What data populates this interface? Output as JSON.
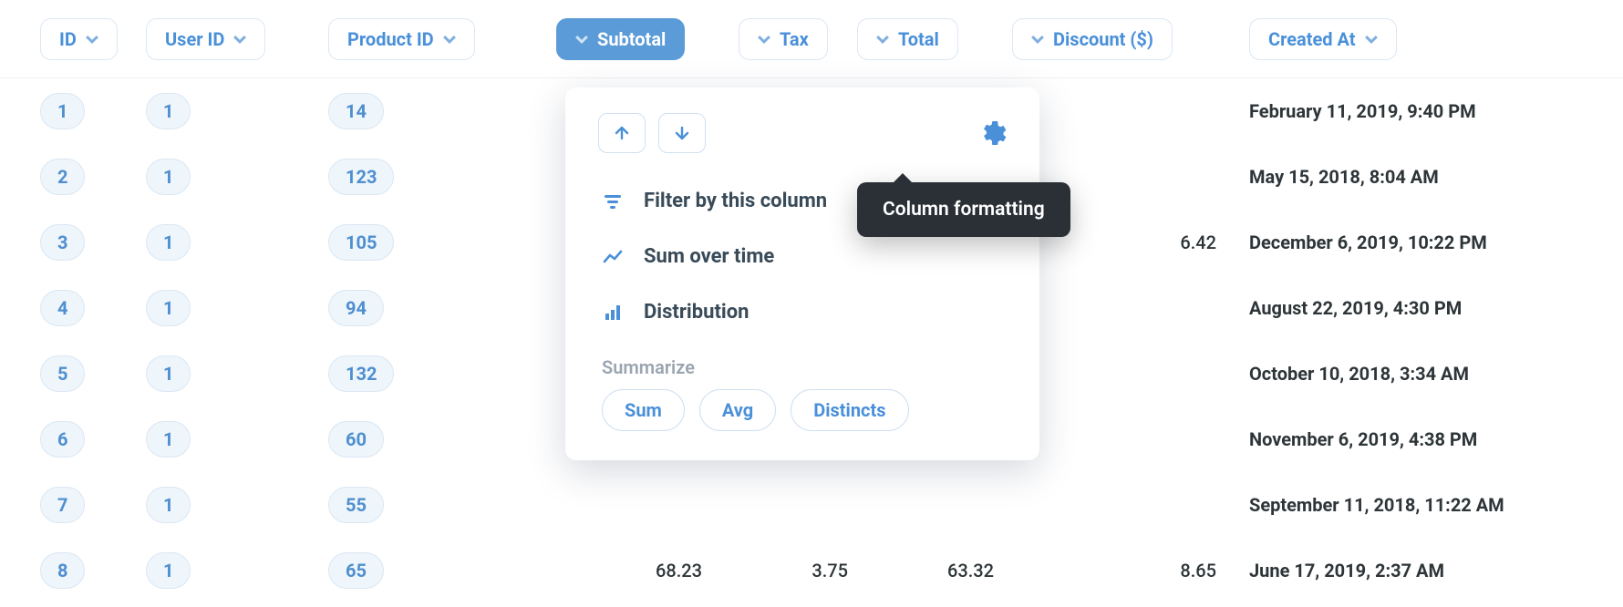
{
  "columns": {
    "id": "ID",
    "user_id": "User ID",
    "product_id": "Product ID",
    "subtotal": "Subtotal",
    "tax": "Tax",
    "total": "Total",
    "discount": "Discount ($)",
    "created_at": "Created At"
  },
  "active_column": "subtotal",
  "rows": [
    {
      "id": "1",
      "user_id": "1",
      "product_id": "14",
      "subtotal": "",
      "tax": "",
      "total": "",
      "discount": "",
      "created_at": "February 11, 2019, 9:40 PM"
    },
    {
      "id": "2",
      "user_id": "1",
      "product_id": "123",
      "subtotal": "",
      "tax": "",
      "total": "",
      "discount": "",
      "created_at": "May 15, 2018, 8:04 AM"
    },
    {
      "id": "3",
      "user_id": "1",
      "product_id": "105",
      "subtotal": "",
      "tax": "",
      "total": "",
      "discount": "6.42",
      "created_at": "December 6, 2019, 10:22 PM"
    },
    {
      "id": "4",
      "user_id": "1",
      "product_id": "94",
      "subtotal": "",
      "tax": "",
      "total": "",
      "discount": "",
      "created_at": "August 22, 2019, 4:30 PM"
    },
    {
      "id": "5",
      "user_id": "1",
      "product_id": "132",
      "subtotal": "",
      "tax": "",
      "total": "",
      "discount": "",
      "created_at": "October 10, 2018, 3:34 AM"
    },
    {
      "id": "6",
      "user_id": "1",
      "product_id": "60",
      "subtotal": "",
      "tax": "",
      "total": "",
      "discount": "",
      "created_at": "November 6, 2019, 4:38 PM"
    },
    {
      "id": "7",
      "user_id": "1",
      "product_id": "55",
      "subtotal": "",
      "tax": "",
      "total": "",
      "discount": "",
      "created_at": "September 11, 2018, 11:22 AM"
    },
    {
      "id": "8",
      "user_id": "1",
      "product_id": "65",
      "subtotal": "68.23",
      "tax": "3.75",
      "total": "63.32",
      "discount": "8.65",
      "created_at": "June 17, 2019, 2:37 AM"
    }
  ],
  "dropdown": {
    "filter_label": "Filter by this column",
    "sum_over_time_label": "Sum over time",
    "distribution_label": "Distribution",
    "summarize_label": "Summarize",
    "chips": {
      "sum": "Sum",
      "avg": "Avg",
      "distincts": "Distincts"
    }
  },
  "tooltip": {
    "text": "Column formatting"
  }
}
